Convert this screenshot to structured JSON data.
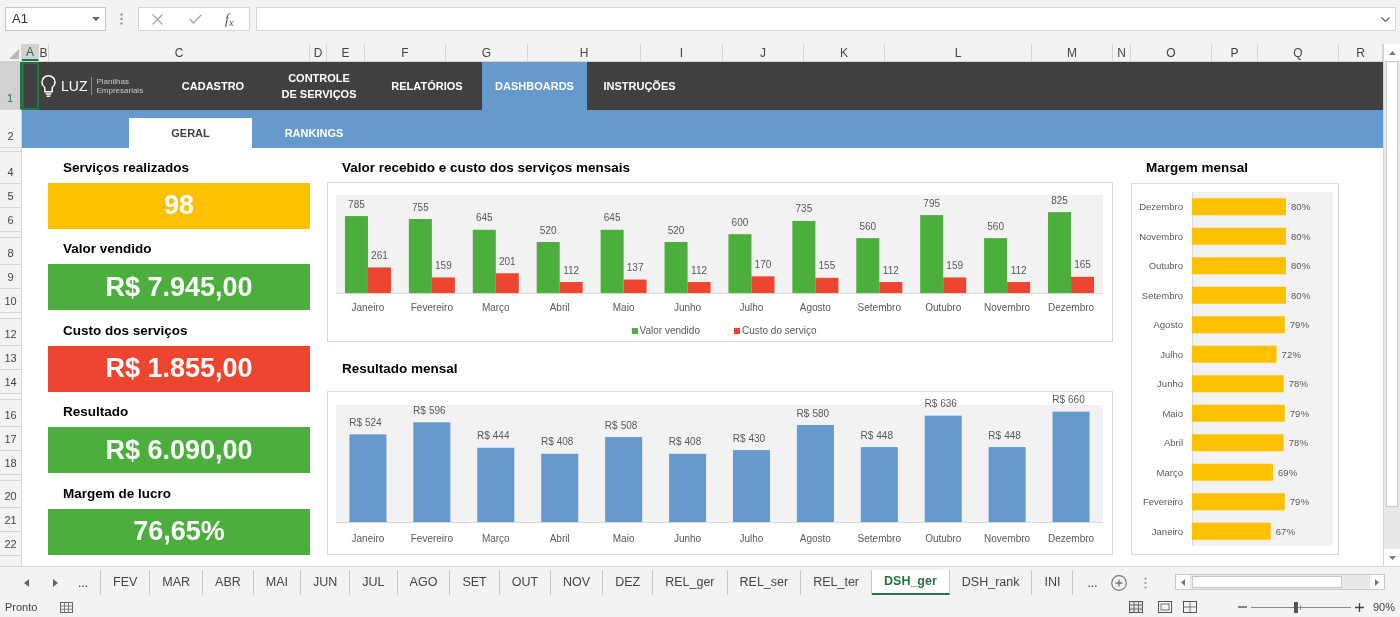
{
  "formula_bar": {
    "name_box": "A1",
    "function_button": "f$_{x}$"
  },
  "columns": [
    {
      "label": "A",
      "selected": true
    },
    {
      "label": "B",
      "selected": false
    },
    {
      "label": "C",
      "selected": false
    },
    {
      "label": "D",
      "selected": false
    },
    {
      "label": "E",
      "selected": false
    },
    {
      "label": "F",
      "selected": false
    },
    {
      "label": "G",
      "selected": false
    },
    {
      "label": "H",
      "selected": false
    },
    {
      "label": "I",
      "selected": false
    },
    {
      "label": "J",
      "selected": false
    },
    {
      "label": "K",
      "selected": false
    },
    {
      "label": "L",
      "selected": false
    },
    {
      "label": "M",
      "selected": false
    },
    {
      "label": "N",
      "selected": false
    },
    {
      "label": "O",
      "selected": false
    },
    {
      "label": "P",
      "selected": false
    },
    {
      "label": "Q",
      "selected": false
    },
    {
      "label": "R",
      "selected": false
    }
  ],
  "rows": [
    {
      "label": "1",
      "selected": true
    },
    {
      "label": "2",
      "selected": false
    },
    {
      "label": "4",
      "selected": false
    },
    {
      "label": "5",
      "selected": false
    },
    {
      "label": "6",
      "selected": false
    },
    {
      "label": "8",
      "selected": false
    },
    {
      "label": "9",
      "selected": false
    },
    {
      "label": "10",
      "selected": false
    },
    {
      "label": "12",
      "selected": false
    },
    {
      "label": "13",
      "selected": false
    },
    {
      "label": "14",
      "selected": false
    },
    {
      "label": "16",
      "selected": false
    },
    {
      "label": "17",
      "selected": false
    },
    {
      "label": "18",
      "selected": false
    },
    {
      "label": "20",
      "selected": false
    },
    {
      "label": "21",
      "selected": false
    },
    {
      "label": "22",
      "selected": false
    }
  ],
  "nav": {
    "logo": {
      "name": "LUZ",
      "tagline": "Planilhas Empresariais"
    },
    "items": [
      {
        "label": "CADASTRO",
        "selected": false
      },
      {
        "label": "CONTROLE DE SERVIÇOS",
        "selected": false
      },
      {
        "label": "RELATÓRIOS",
        "selected": false
      },
      {
        "label": "DASHBOARDS",
        "selected": true
      },
      {
        "label": "INSTRUÇÕES",
        "selected": false
      }
    ]
  },
  "subnav": [
    {
      "label": "GERAL",
      "selected": true
    },
    {
      "label": "RANKINGS",
      "selected": false
    }
  ],
  "kpis": [
    {
      "label": "Serviços realizados",
      "value": "98",
      "color": "#ffc000"
    },
    {
      "label": "Valor vendido",
      "value": "R$ 7.945,00",
      "color": "#4cae3d"
    },
    {
      "label": "Custo dos serviços",
      "value": "R$ 1.855,00",
      "color": "#ee4530"
    },
    {
      "label": "Resultado",
      "value": "R$ 6.090,00",
      "color": "#4cae3d"
    },
    {
      "label": "Margem de lucro",
      "value": "76,65%",
      "color": "#4cae3d"
    }
  ],
  "charts": [
    {
      "chart_data": {
        "type": "bar",
        "title": "Valor recebido e custo dos serviços mensais",
        "orientation": "vertical",
        "categories": [
          "Janeiro",
          "Fevereiro",
          "Março",
          "Abril",
          "Maio",
          "Junho",
          "Julho",
          "Agosto",
          "Setembro",
          "Outubro",
          "Novembro",
          "Dezembro"
        ],
        "series": [
          {
            "name": "Valor vendido",
            "color": "#4cae3d",
            "values": [
              785,
              755,
              645,
              520,
              645,
              520,
              600,
              735,
              560,
              795,
              560,
              825
            ]
          },
          {
            "name": "Custo do serviço",
            "color": "#ee4530",
            "values": [
              261,
              159,
              201,
              112,
              137,
              112,
              170,
              155,
              112,
              159,
              112,
              165
            ]
          }
        ],
        "ylim": [
          0,
          1000
        ],
        "data_labels": true,
        "legend": "bottom"
      }
    },
    {
      "label_prefixes": [
        "R$",
        "R$",
        "R$",
        "R$",
        "R$",
        "R$",
        "R$",
        "R$",
        "R$",
        "R$",
        "R$",
        "R$"
      ],
      "chart_data": {
        "type": "bar",
        "title": "Resultado mensal",
        "orientation": "vertical",
        "categories": [
          "Janeiro",
          "Fevereiro",
          "Março",
          "Abril",
          "Maio",
          "Junho",
          "Julho",
          "Agosto",
          "Setembro",
          "Outubro",
          "Novembro",
          "Dezembro"
        ],
        "series": [
          {
            "color": "#6699cc",
            "values": [
              524,
              596,
              444,
              408,
              508,
              408,
              430,
              580,
              448,
              636,
              448,
              660
            ]
          }
        ],
        "data_labels": true
      }
    },
    {
      "label_suffixes": [
        "%",
        "%",
        "%",
        "%",
        "%",
        "%",
        "%",
        "%",
        "%",
        "%",
        "%",
        "%"
      ],
      "chart_data": {
        "type": "bar",
        "title": "Margem mensal",
        "orientation": "horizontal",
        "categories": [
          "Dezembro",
          "Novembro",
          "Outubro",
          "Setembro",
          "Agosto",
          "Julho",
          "Junho",
          "Maio",
          "Abril",
          "Março",
          "Fevereiro",
          "Janeiro"
        ],
        "series": [
          {
            "color": "#ffc000",
            "values": [
              80,
              80,
              80,
              80,
              79,
              72,
              78,
              79,
              78,
              69,
              79,
              67
            ]
          }
        ],
        "data_labels": true
      }
    }
  ],
  "sheet_tabs": {
    "more_left": "...",
    "tabs": [
      {
        "label": "FEV",
        "selected": false
      },
      {
        "label": "MAR",
        "selected": false
      },
      {
        "label": "ABR",
        "selected": false
      },
      {
        "label": "MAI",
        "selected": false
      },
      {
        "label": "JUN",
        "selected": false
      },
      {
        "label": "JUL",
        "selected": false
      },
      {
        "label": "AGO",
        "selected": false
      },
      {
        "label": "SET",
        "selected": false
      },
      {
        "label": "OUT",
        "selected": false
      },
      {
        "label": "NOV",
        "selected": false
      },
      {
        "label": "DEZ",
        "selected": false
      },
      {
        "label": "REL_ger",
        "selected": false
      },
      {
        "label": "REL_ser",
        "selected": false
      },
      {
        "label": "REL_ter",
        "selected": false
      },
      {
        "label": "DSH_ger",
        "selected": true
      },
      {
        "label": "DSH_rank",
        "selected": false
      },
      {
        "label": "INI",
        "selected": false
      }
    ],
    "more_right": "..."
  },
  "status_bar": {
    "status": "Pronto",
    "zoom": {
      "level": 0.45,
      "reading": "90%"
    }
  }
}
